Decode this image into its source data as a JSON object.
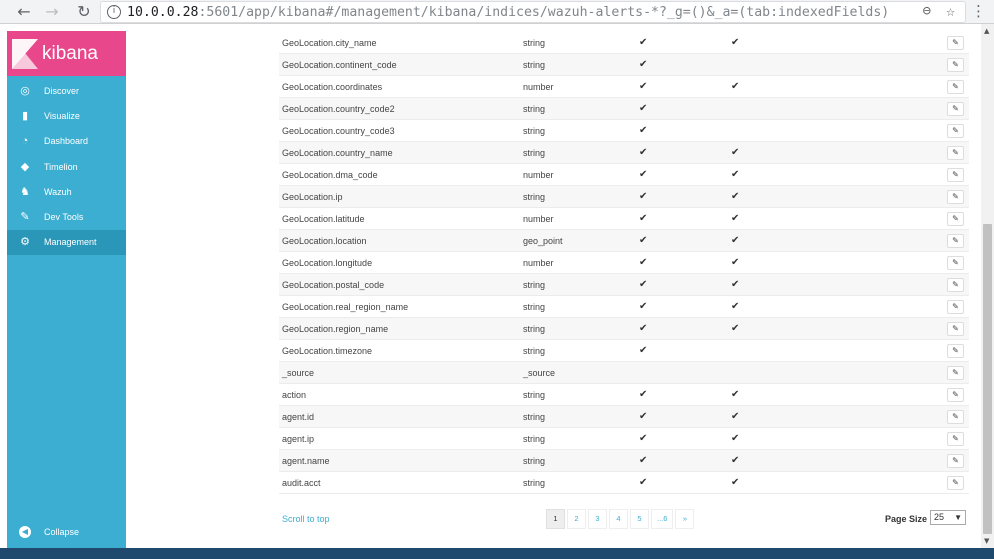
{
  "browser": {
    "url_host": "10.0.0.28",
    "url_rest": ":5601/app/kibana#/management/kibana/indices/wazuh-alerts-*?_g=()&_a=(tab:indexedFields)"
  },
  "sidebar": {
    "brand": "kibana",
    "items": [
      {
        "label": "Discover",
        "icon": "compass-icon"
      },
      {
        "label": "Visualize",
        "icon": "bar-chart-icon"
      },
      {
        "label": "Dashboard",
        "icon": "dashboard-icon"
      },
      {
        "label": "Timelion",
        "icon": "timelion-icon"
      },
      {
        "label": "Wazuh",
        "icon": "wazuh-icon"
      },
      {
        "label": "Dev Tools",
        "icon": "wrench-icon"
      },
      {
        "label": "Management",
        "icon": "gear-icon",
        "active": true
      }
    ],
    "collapse_label": "Collapse"
  },
  "fields": [
    {
      "name": "GeoLocation.city_name",
      "type": "string",
      "searchable": "✔",
      "aggregatable": "✔"
    },
    {
      "name": "GeoLocation.continent_code",
      "type": "string",
      "searchable": "✔",
      "aggregatable": ""
    },
    {
      "name": "GeoLocation.coordinates",
      "type": "number",
      "searchable": "✔",
      "aggregatable": "✔"
    },
    {
      "name": "GeoLocation.country_code2",
      "type": "string",
      "searchable": "✔",
      "aggregatable": ""
    },
    {
      "name": "GeoLocation.country_code3",
      "type": "string",
      "searchable": "✔",
      "aggregatable": ""
    },
    {
      "name": "GeoLocation.country_name",
      "type": "string",
      "searchable": "✔",
      "aggregatable": "✔"
    },
    {
      "name": "GeoLocation.dma_code",
      "type": "number",
      "searchable": "✔",
      "aggregatable": "✔"
    },
    {
      "name": "GeoLocation.ip",
      "type": "string",
      "searchable": "✔",
      "aggregatable": "✔"
    },
    {
      "name": "GeoLocation.latitude",
      "type": "number",
      "searchable": "✔",
      "aggregatable": "✔"
    },
    {
      "name": "GeoLocation.location",
      "type": "geo_point",
      "searchable": "✔",
      "aggregatable": "✔"
    },
    {
      "name": "GeoLocation.longitude",
      "type": "number",
      "searchable": "✔",
      "aggregatable": "✔"
    },
    {
      "name": "GeoLocation.postal_code",
      "type": "string",
      "searchable": "✔",
      "aggregatable": "✔"
    },
    {
      "name": "GeoLocation.real_region_name",
      "type": "string",
      "searchable": "✔",
      "aggregatable": "✔"
    },
    {
      "name": "GeoLocation.region_name",
      "type": "string",
      "searchable": "✔",
      "aggregatable": "✔"
    },
    {
      "name": "GeoLocation.timezone",
      "type": "string",
      "searchable": "✔",
      "aggregatable": ""
    },
    {
      "name": "_source",
      "type": "_source",
      "searchable": "",
      "aggregatable": ""
    },
    {
      "name": "action",
      "type": "string",
      "searchable": "✔",
      "aggregatable": "✔"
    },
    {
      "name": "agent.id",
      "type": "string",
      "searchable": "✔",
      "aggregatable": "✔"
    },
    {
      "name": "agent.ip",
      "type": "string",
      "searchable": "✔",
      "aggregatable": "✔"
    },
    {
      "name": "agent.name",
      "type": "string",
      "searchable": "✔",
      "aggregatable": "✔"
    },
    {
      "name": "audit.acct",
      "type": "string",
      "searchable": "✔",
      "aggregatable": "✔"
    }
  ],
  "footer": {
    "scroll_to_top": "Scroll to top",
    "pages": [
      "1",
      "2",
      "3",
      "4",
      "5",
      "...6",
      "»"
    ],
    "current_page": "1",
    "page_size_label": "Page Size",
    "page_size_value": "25"
  }
}
